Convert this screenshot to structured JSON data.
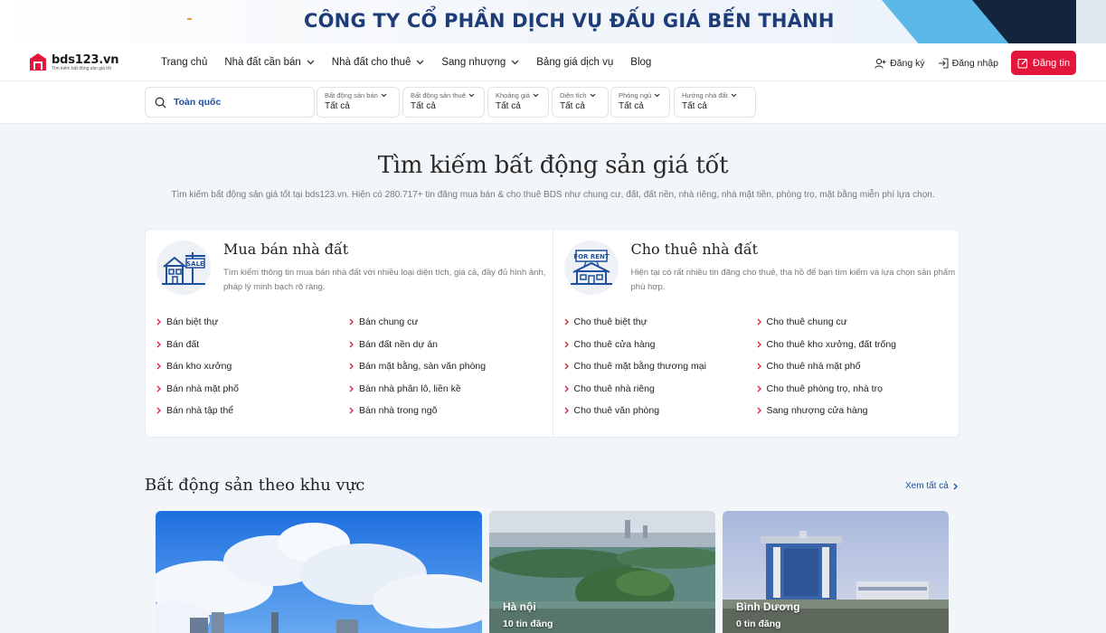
{
  "banner": {
    "title": "CÔNG TY CỔ PHẦN DỊCH VỤ ĐẤU GIÁ BẾN THÀNH"
  },
  "logo": {
    "name": "bds123.vn",
    "tagline": "Tìm kiếm bất động sản giá tốt"
  },
  "nav": {
    "items": [
      {
        "label": "Trang chủ",
        "dropdown": false
      },
      {
        "label": "Nhà đất cần bán",
        "dropdown": true
      },
      {
        "label": "Nhà đất cho thuê",
        "dropdown": true
      },
      {
        "label": "Sang nhượng",
        "dropdown": true
      },
      {
        "label": "Bảng giá dịch vụ",
        "dropdown": false
      },
      {
        "label": "Blog",
        "dropdown": false
      }
    ]
  },
  "auth": {
    "register": "Đăng ký",
    "login": "Đăng nhập",
    "post": "Đăng tin"
  },
  "filters": {
    "search": "Toàn quốc",
    "items": [
      {
        "label": "Bất động sản bán",
        "value": "Tất cả"
      },
      {
        "label": "Bất động sản thuê",
        "value": "Tất cả"
      },
      {
        "label": "Khoảng giá",
        "value": "Tất cả"
      },
      {
        "label": "Diện tích",
        "value": "Tất cả"
      },
      {
        "label": "Phòng ngủ",
        "value": "Tất cả"
      },
      {
        "label": "Hướng nhà đất",
        "value": "Tất cả"
      }
    ]
  },
  "hero": {
    "title": "Tìm kiếm bất động sản giá tốt",
    "subtitle": "Tìm kiếm bất động sản giá tốt tại bds123.vn. Hiện có 280.717+ tin đăng mua bán & cho thuê BDS như chung cư, đất, đất nền, nhà riêng, nhà mặt tiền, phòng trọ, mặt bằng miễn phí lựa chọn."
  },
  "categories": [
    {
      "title": "Mua bán nhà đất",
      "icon_label": "SALE",
      "description": "Tìm kiếm thông tin mua bán nhà đất với nhiều loại diện tích, giá cả, đầy đủ hình ảnh, pháp lý minh bạch rõ ràng.",
      "links": [
        "Bán biệt thự",
        "Bán chung cư",
        "Bán đất",
        "Bán đất nền dự án",
        "Bán kho xưởng",
        "Bán mặt bằng, sàn văn phòng",
        "Bán nhà mặt phố",
        "Bán nhà phân lô, liền kề",
        "Bán nhà tập thể",
        "Bán nhà trong ngõ"
      ]
    },
    {
      "title": "Cho thuê nhà đất",
      "icon_label": "FOR RENT",
      "description": "Hiện tại có rất nhiều tin đăng cho thuê, tha hồ để bạn tìm kiếm và lựa chọn sản phẩm phù hợp.",
      "links": [
        "Cho thuê biệt thự",
        "Cho thuê chung cư",
        "Cho thuê cửa hàng",
        "Cho thuê kho xưởng, đất trống",
        "Cho thuê mặt bằng thương mại",
        "Cho thuê nhà mặt phố",
        "Cho thuê nhà riêng",
        "Cho thuê phòng trọ, nhà trọ",
        "Cho thuê văn phòng",
        "Sang nhượng cửa hàng"
      ]
    }
  ],
  "regions": {
    "title": "Bất động sản theo khu vực",
    "see_all": "Xem tất cả",
    "items": [
      {
        "name": "",
        "count": ""
      },
      {
        "name": "Hà nội",
        "count": "10 tin đăng"
      },
      {
        "name": "Bình Dương",
        "count": "0 tin đăng"
      }
    ]
  },
  "colors": {
    "brand_red": "#e3173b",
    "link_blue": "#1d4e9e",
    "chevron_red": "#d81e3c"
  }
}
